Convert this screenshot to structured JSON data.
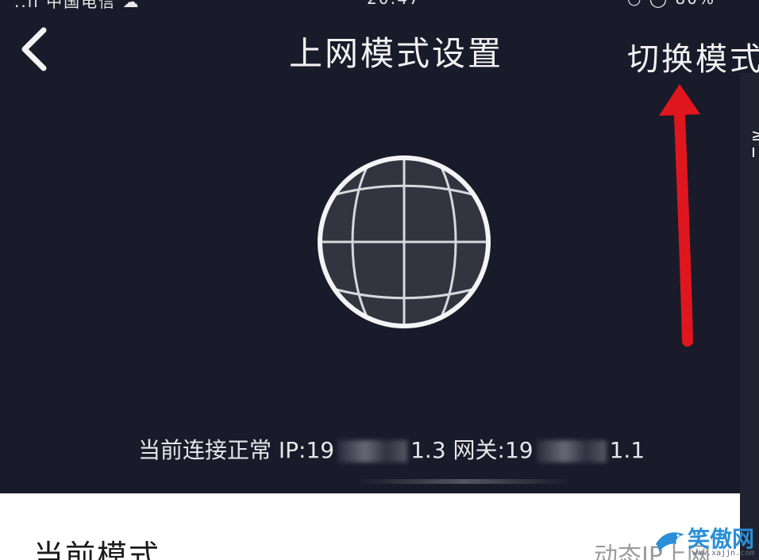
{
  "statusbar": {
    "carrier": "..ıı 中国电信 ☁",
    "time": "20:47",
    "battery": "◔ ◯ 80%"
  },
  "header": {
    "title": "上网模式设置",
    "switch_mode": "切换模式"
  },
  "connection": {
    "prefix": "当前连接正常 IP:19",
    "ip_tail": "1.3",
    "gateway_label": " 网关:19",
    "gateway_tail": "1.1"
  },
  "current_mode": {
    "label": "当前模式",
    "value": "动态IP上网"
  },
  "watermark": {
    "text": "笑傲网",
    "url": "www.xajjn.com"
  },
  "colors": {
    "background": "#191b2a",
    "arrow": "#e0161f",
    "card": "#ffffff"
  }
}
